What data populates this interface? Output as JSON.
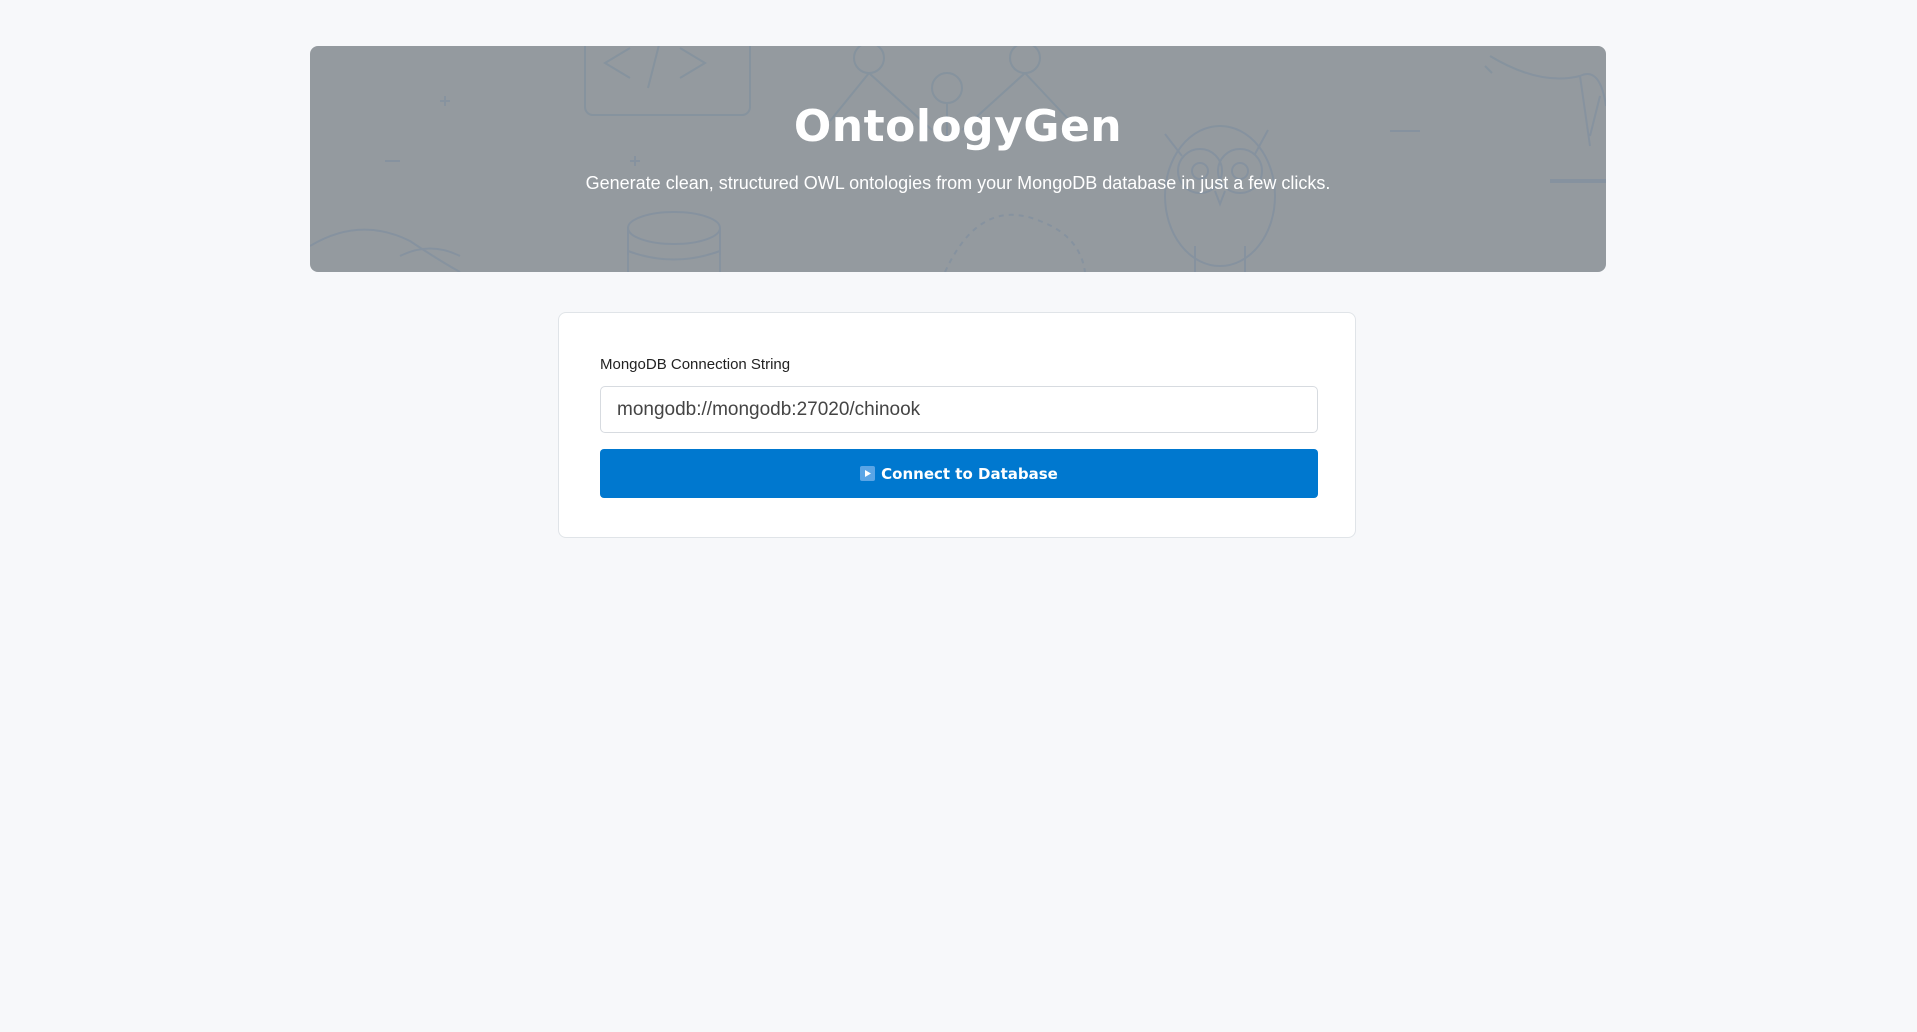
{
  "header": {
    "title": "OntologyGen",
    "subtitle": "Generate clean, structured OWL ontologies from your MongoDB database in just a few clicks."
  },
  "form": {
    "label": "MongoDB Connection String",
    "connection_value": "mongodb://mongodb:27020/chinook",
    "connect_button": {
      "icon": "play-icon",
      "label": "Connect to Database"
    }
  },
  "colors": {
    "page_background": "#f7f8fa",
    "hero_background": "#949a9f",
    "button_primary": "#0078cf",
    "text_white": "#ffffff"
  }
}
